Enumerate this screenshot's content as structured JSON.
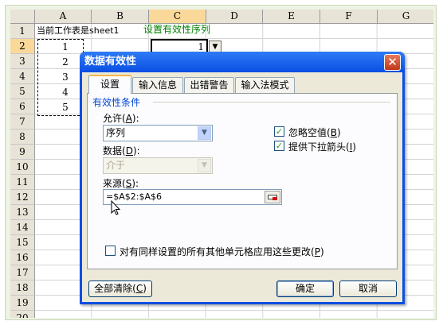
{
  "sheet": {
    "columns": [
      "A",
      "B",
      "C",
      "D",
      "E",
      "F",
      "G"
    ],
    "rows": [
      "1",
      "2",
      "3",
      "4",
      "5",
      "6",
      "7",
      "8",
      "9",
      "10",
      "11",
      "12",
      "13",
      "14",
      "15",
      "16",
      "17",
      "18",
      "19",
      "20"
    ],
    "a1_text": "当前工作表是sheet1",
    "c1_text": "设置有效性序列",
    "a_values": [
      "1",
      "2",
      "3",
      "4",
      "5"
    ],
    "c2_value": "1",
    "dropdown_glyph": "▼"
  },
  "dialog": {
    "title": "数据有效性",
    "close_glyph": "✕",
    "tabs": [
      "设置",
      "输入信息",
      "出错警告",
      "输入法模式"
    ],
    "group_label": "有效性条件",
    "allow_label": "允许",
    "allow_key": "A",
    "allow_value": "序列",
    "data_label": "数据",
    "data_key": "D",
    "data_value": "介于",
    "source_label": "来源",
    "source_key": "S",
    "source_value": "=$A$2:$A$6",
    "ignore_blank_label": "忽略空值",
    "ignore_blank_key": "B",
    "ignore_blank_checked": true,
    "dropdown_label": "提供下拉箭头",
    "dropdown_key": "I",
    "dropdown_checked": true,
    "apply_all_label": "对有同样设置的所有其他单元格应用这些更改",
    "apply_all_key": "P",
    "apply_all_checked": false,
    "clear_all_label": "全部清除",
    "clear_all_key": "C",
    "ok_label": "确定",
    "cancel_label": "取消",
    "check_glyph": "✓",
    "select_arrow_glyph": "▼",
    "colon": ":"
  },
  "colors": {
    "titlebar": "#0a4ee3",
    "group_label": "#0046d5",
    "c1_text": "#008000",
    "check": "#21a121"
  }
}
